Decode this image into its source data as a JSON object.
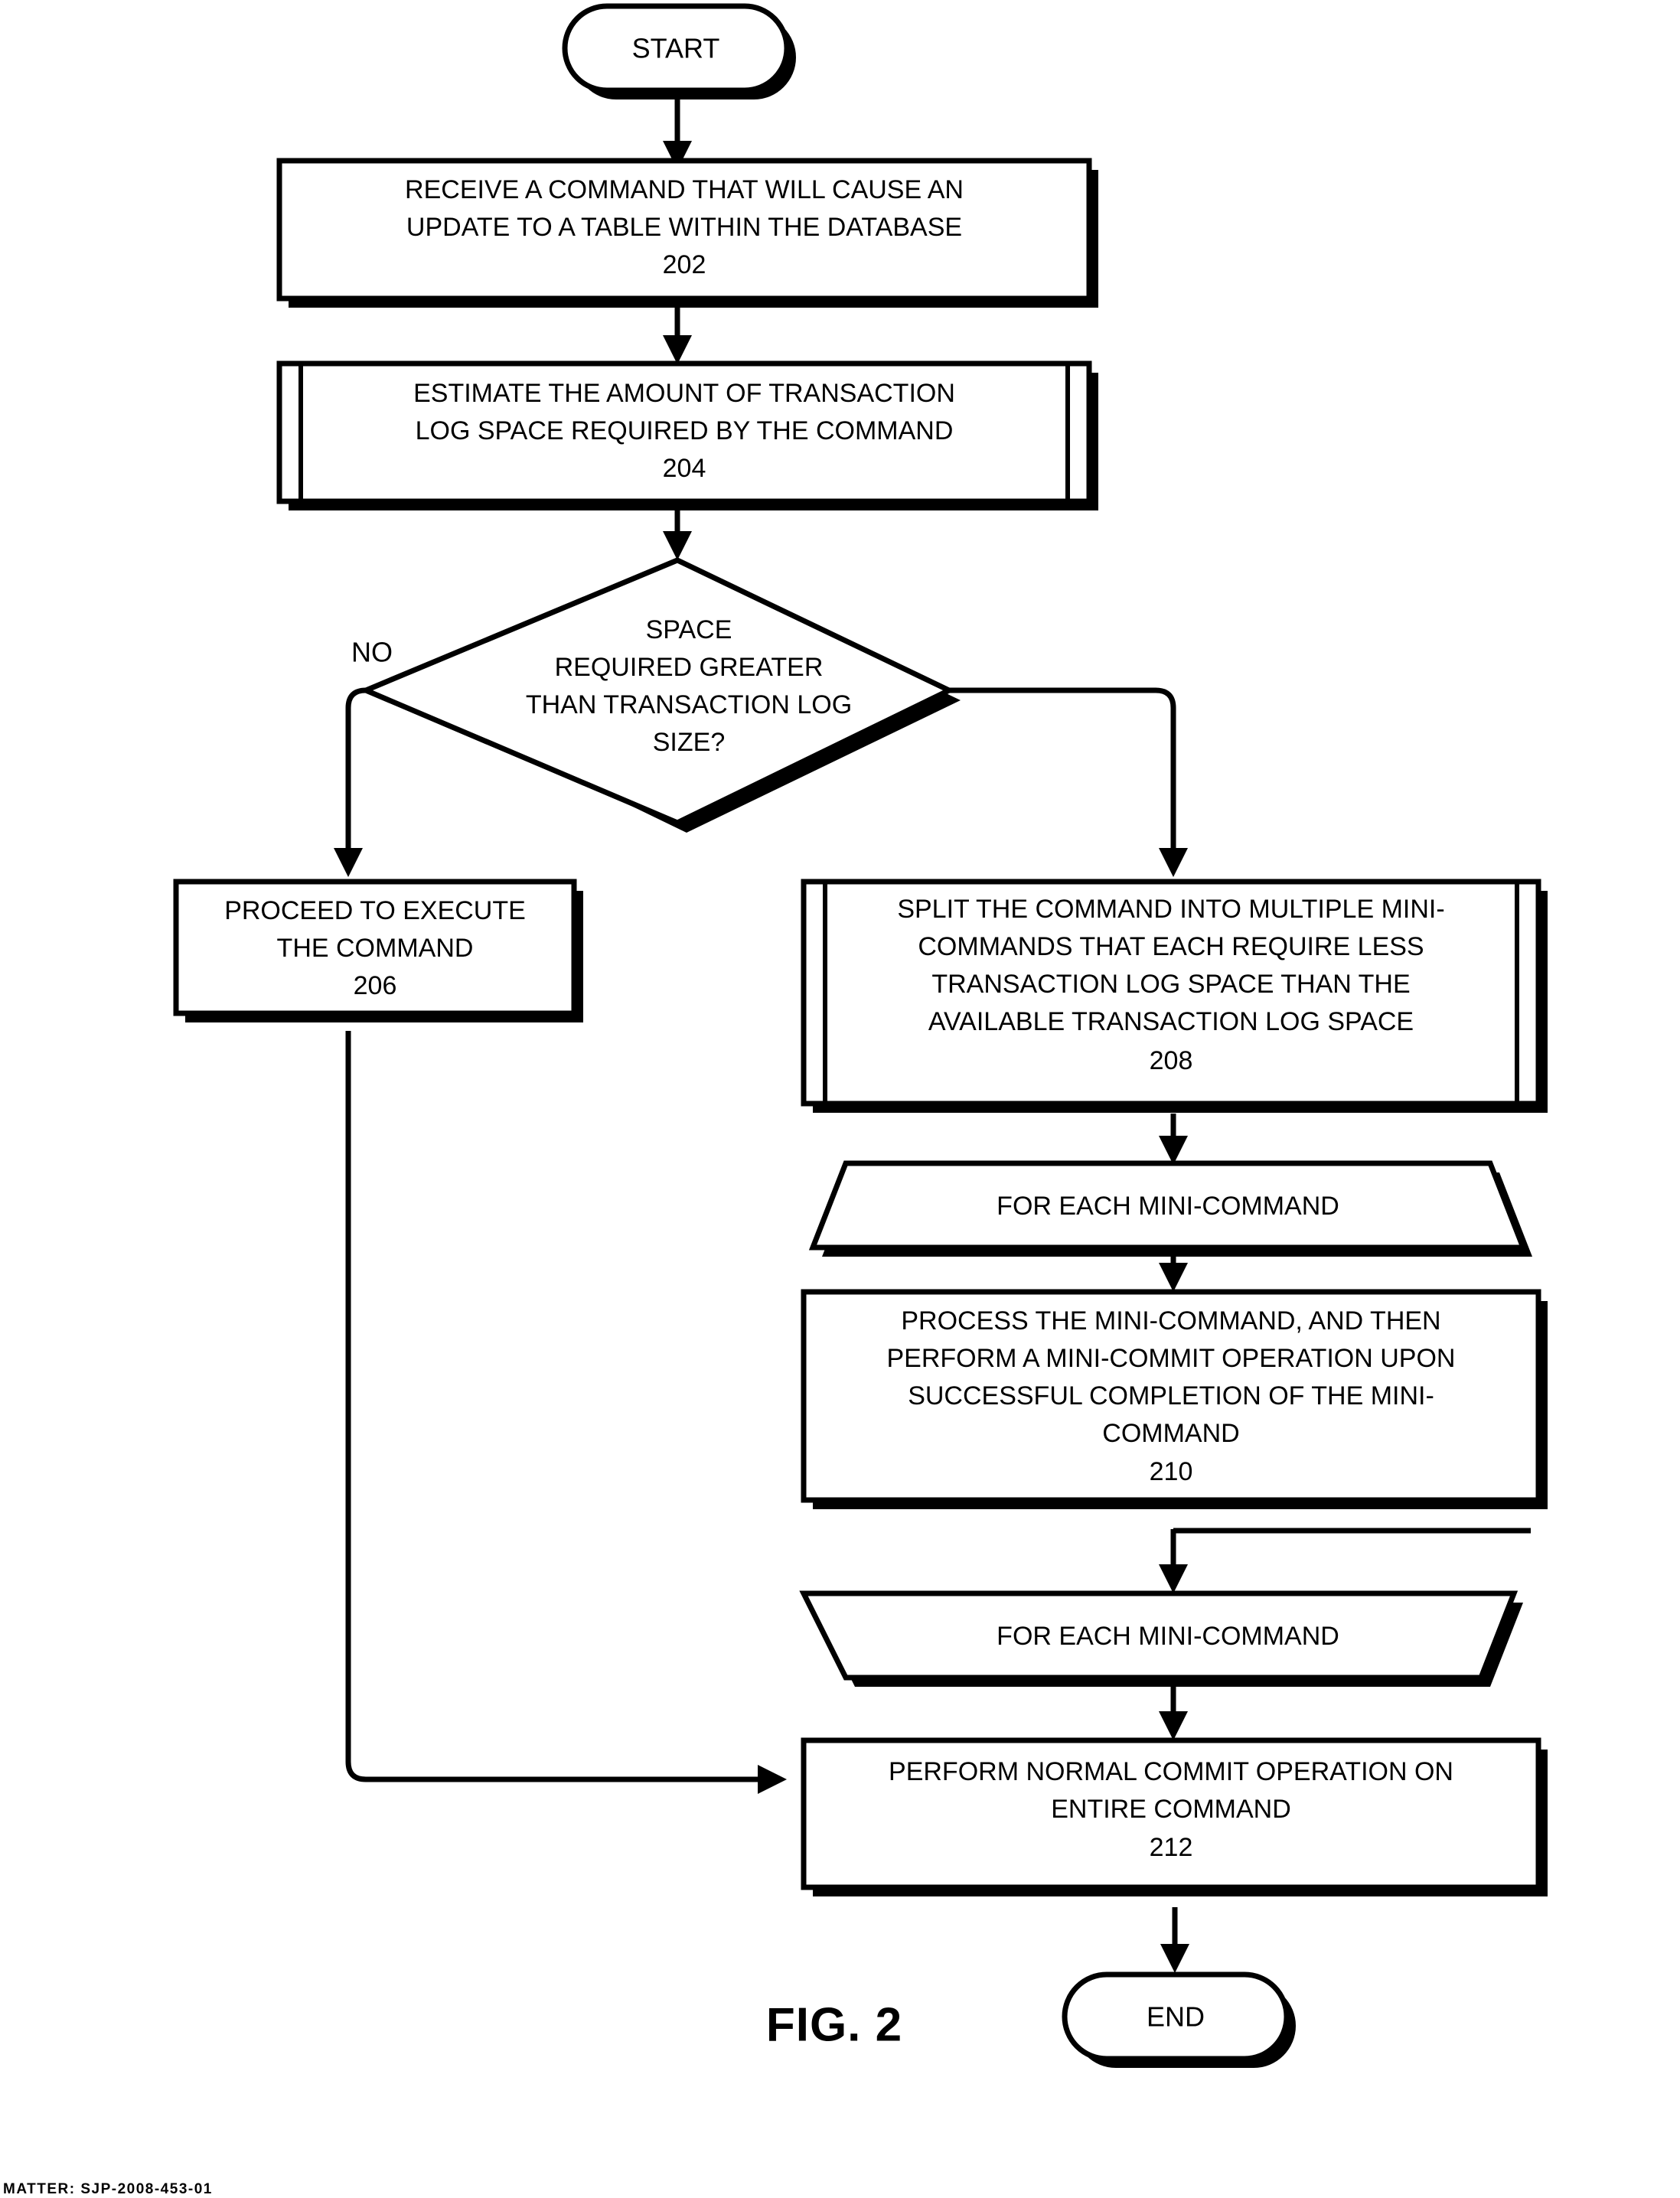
{
  "figure": {
    "caption": "FIG. 2",
    "footer_partial": "MATTER: SJP-2008-453-01"
  },
  "nodes": {
    "start": {
      "label": "START",
      "shape": "terminator"
    },
    "n202": {
      "lines": [
        "RECEIVE A COMMAND THAT WILL CAUSE AN",
        "UPDATE TO A TABLE WITHIN THE DATABASE"
      ],
      "ref": "202",
      "shape": "process"
    },
    "n204": {
      "lines": [
        "ESTIMATE THE AMOUNT OF TRANSACTION",
        "LOG SPACE REQUIRED BY THE COMMAND"
      ],
      "ref": "204",
      "shape": "predefined-process"
    },
    "decision": {
      "lines": [
        "SPACE",
        "REQUIRED GREATER",
        "THAN TRANSACTION LOG",
        "SIZE?"
      ],
      "shape": "decision"
    },
    "n206": {
      "lines": [
        "PROCEED TO EXECUTE",
        "THE COMMAND"
      ],
      "ref": "206",
      "shape": "process"
    },
    "n208": {
      "lines": [
        "SPLIT THE COMMAND INTO MULTIPLE MINI-",
        "COMMANDS THAT EACH REQUIRE LESS",
        "TRANSACTION LOG SPACE THAN THE",
        "AVAILABLE TRANSACTION LOG SPACE"
      ],
      "ref": "208",
      "shape": "predefined-process"
    },
    "loop_start": {
      "label": "FOR EACH MINI-COMMAND",
      "shape": "loop-start-trapezoid"
    },
    "n210": {
      "lines": [
        "PROCESS THE MINI-COMMAND, AND THEN",
        "PERFORM A MINI-COMMIT OPERATION UPON",
        "SUCCESSFUL COMPLETION OF THE MINI-",
        "COMMAND"
      ],
      "ref": "210",
      "shape": "process"
    },
    "loop_end": {
      "label": "FOR EACH MINI-COMMAND",
      "shape": "loop-end-trapezoid"
    },
    "n212": {
      "lines": [
        "PERFORM NORMAL COMMIT OPERATION ON",
        "ENTIRE COMMAND"
      ],
      "ref": "212",
      "shape": "process"
    },
    "end": {
      "label": "END",
      "shape": "terminator"
    }
  },
  "edges": {
    "no_label": "NO"
  },
  "colors": {
    "stroke": "#000000",
    "fill": "#ffffff",
    "shadow": "#000000",
    "background": "#ffffff"
  }
}
